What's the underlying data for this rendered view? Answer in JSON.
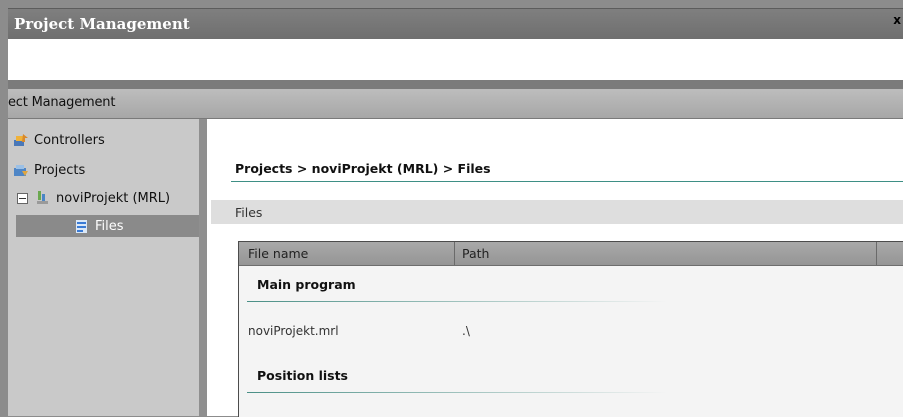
{
  "window": {
    "title": "Project Management",
    "close_glyph": "x"
  },
  "section_header": {
    "label": "ect Management"
  },
  "tree": {
    "items": [
      {
        "label": "Controllers",
        "icon": "controllers-icon"
      },
      {
        "label": "Projects",
        "icon": "projects-icon"
      },
      {
        "label": "noviProjekt (MRL)",
        "icon": "project-icon",
        "expander": "collapse"
      },
      {
        "label": "Files",
        "icon": "files-icon",
        "selected": true
      }
    ]
  },
  "content": {
    "breadcrumb": "Projects > noviProjekt (MRL) > Files",
    "files_band_label": "Files",
    "grid": {
      "columns": [
        "File name",
        "Path"
      ],
      "groups": [
        {
          "title": "Main program",
          "rows": [
            {
              "file": "noviProjekt.mrl",
              "path": ".\\"
            }
          ]
        },
        {
          "title": "Position lists",
          "rows": []
        }
      ]
    }
  },
  "colors": {
    "accent_rule": "#3e8f85",
    "selected_bg": "#8a8a8a"
  }
}
